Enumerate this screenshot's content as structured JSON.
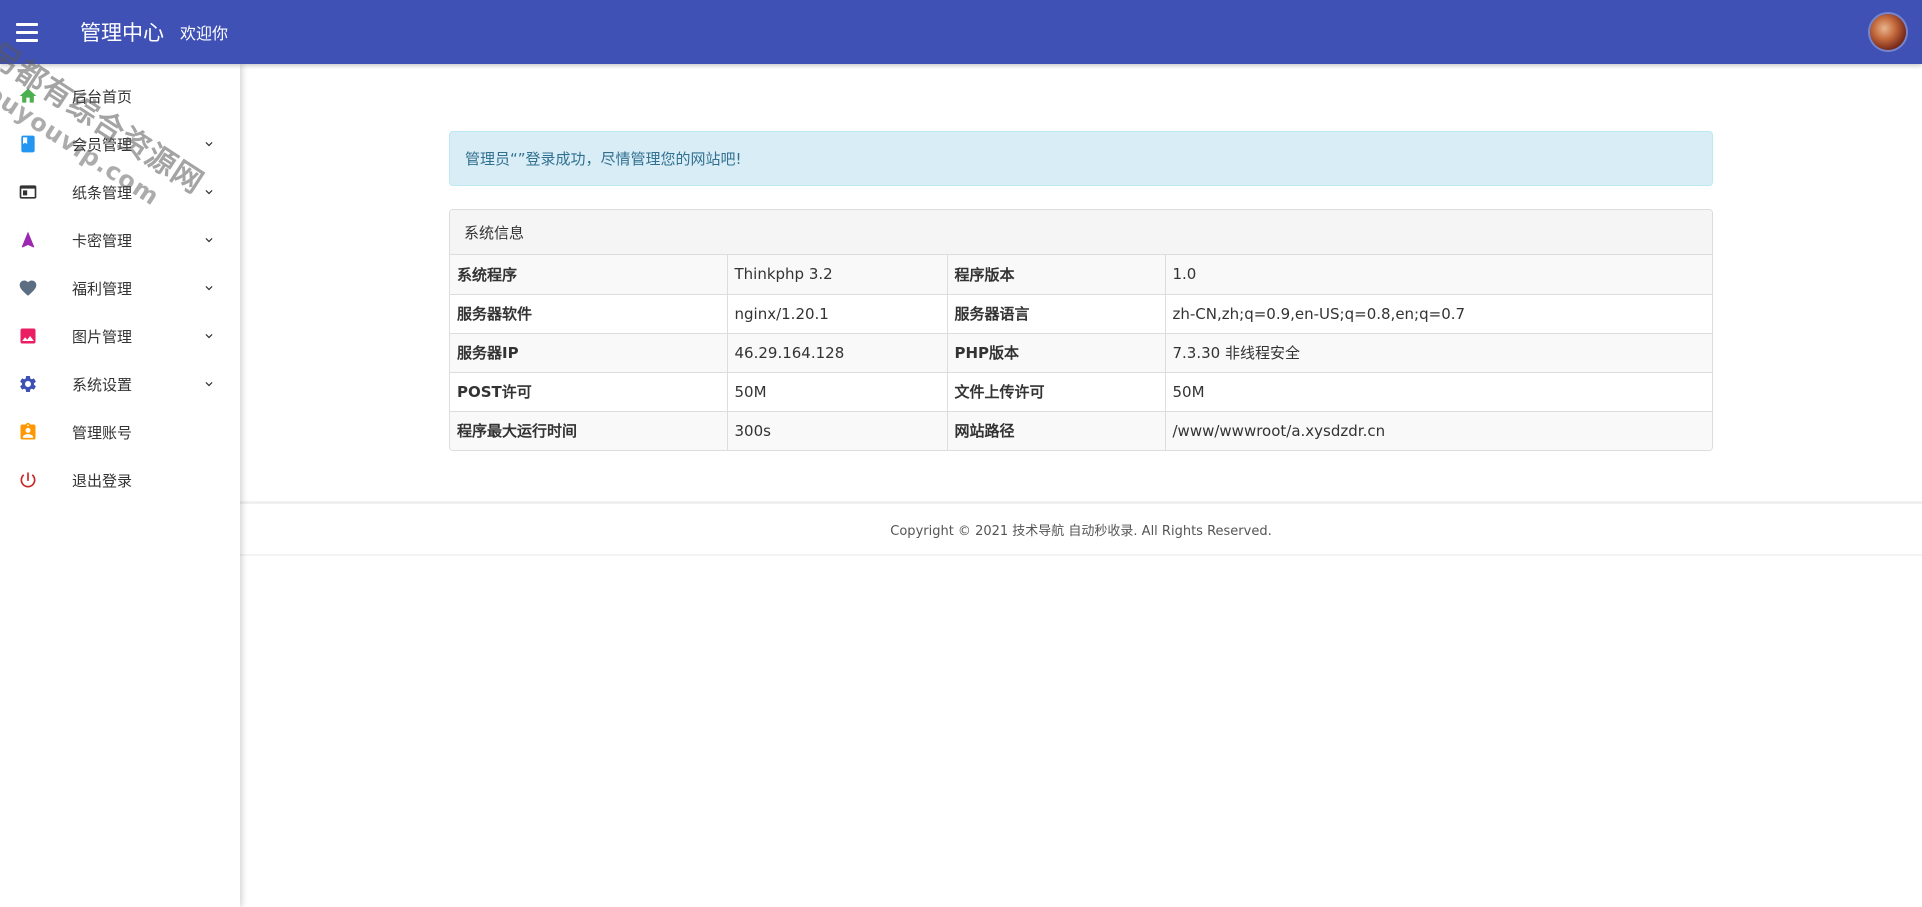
{
  "header": {
    "title": "管理中心",
    "welcome": "欢迎你"
  },
  "sidebar": {
    "items": [
      {
        "label": "后台首页",
        "icon": "home-icon",
        "color": "#4caf50",
        "expandable": false
      },
      {
        "label": "会员管理",
        "icon": "book-icon",
        "color": "#2196f3",
        "expandable": true
      },
      {
        "label": "纸条管理",
        "icon": "window-icon",
        "color": "#333333",
        "expandable": true
      },
      {
        "label": "卡密管理",
        "icon": "navigation-arrow-icon",
        "color": "#9c27b0",
        "expandable": true
      },
      {
        "label": "福利管理",
        "icon": "heart-icon",
        "color": "#607d8b",
        "expandable": true
      },
      {
        "label": "图片管理",
        "icon": "image-icon",
        "color": "#e91e63",
        "expandable": true
      },
      {
        "label": "系统设置",
        "icon": "gear-icon",
        "color": "#3f51b5",
        "expandable": true
      },
      {
        "label": "管理账号",
        "icon": "badge-icon",
        "color": "#ff9800",
        "expandable": false
      },
      {
        "label": "退出登录",
        "icon": "power-icon",
        "color": "#f44336",
        "expandable": false
      }
    ]
  },
  "watermark": {
    "cn": "另都有综合资源网",
    "en": "douyouvip.com"
  },
  "alert": {
    "text": "管理员“”登录成功，尽情管理您的网站吧!"
  },
  "system_info": {
    "heading": "系统信息",
    "rows": [
      [
        "系统程序",
        "Thinkphp 3.2",
        "程序版本",
        "1.0"
      ],
      [
        "服务器软件",
        "nginx/1.20.1",
        "服务器语言",
        "zh-CN,zh;q=0.9,en-US;q=0.8,en;q=0.7"
      ],
      [
        "服务器IP",
        "46.29.164.128",
        "PHP版本",
        "7.3.30 非线程安全"
      ],
      [
        "POST许可",
        "50M",
        "文件上传许可",
        "50M"
      ],
      [
        "程序最大运行时间",
        "300s",
        "网站路径",
        "/www/wwwroot/a.xysdzdr.cn"
      ]
    ]
  },
  "footer": {
    "text": "Copyright © 2021 技术导航 自动秒收录. All Rights Reserved."
  },
  "colors": {
    "header_bg": "#3f51b5",
    "alert_bg": "#d9edf7",
    "alert_text": "#31708f"
  }
}
